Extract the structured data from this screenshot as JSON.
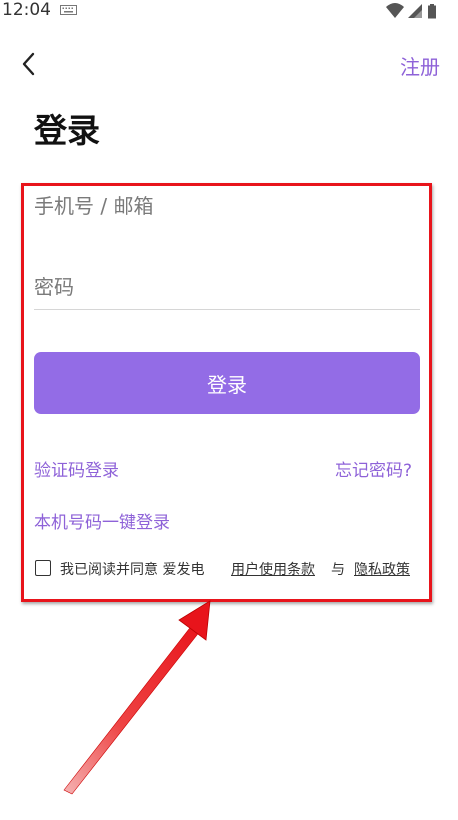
{
  "status_bar": {
    "time": "12:04",
    "icons": [
      "keyboard-icon",
      "wifi-icon",
      "signal-icon",
      "battery-icon"
    ]
  },
  "app_bar": {
    "back_icon": "chevron-left-icon",
    "register_label": "注册"
  },
  "page": {
    "title": "登录"
  },
  "form": {
    "account_placeholder": "手机号 / 邮箱",
    "account_value": "",
    "password_placeholder": "密码",
    "password_value": "",
    "login_button_label": "登录"
  },
  "links": {
    "sms_login": "验证码登录",
    "forgot_password": "忘记密码?",
    "onekey_login": "本机号码一键登录"
  },
  "agreement": {
    "checked": false,
    "text": "我已阅读并同意 爱发电",
    "terms_label": "用户使用条款",
    "and_label": "与",
    "privacy_label": "隐私政策"
  },
  "colors": {
    "accent": "#936ce6",
    "link": "#8e62d8",
    "annotation": "#e8141b"
  }
}
